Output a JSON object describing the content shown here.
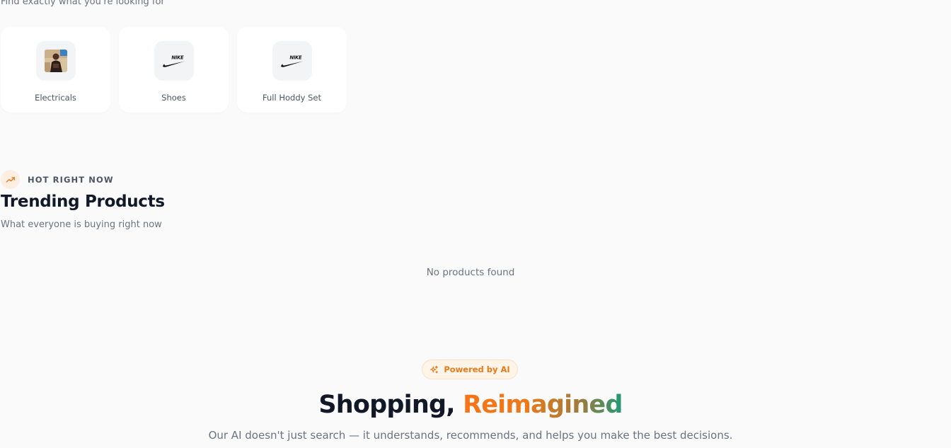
{
  "categories": {
    "subtitle": "Find exactly what you're looking for",
    "items": [
      {
        "label": "Electricals",
        "icon": "photo-thumbnail"
      },
      {
        "label": "Shoes",
        "icon": "nike-logo"
      },
      {
        "label": "Full Hoddy Set",
        "icon": "nike-logo"
      }
    ]
  },
  "trending": {
    "eyebrow": "HOT RIGHT NOW",
    "eyebrow_icon": "trending-up-icon",
    "title": "Trending Products",
    "subtitle": "What everyone is buying right now",
    "empty_message": "No products found"
  },
  "ai_section": {
    "pill_icon": "sparkles-icon",
    "pill_label": "Powered by AI",
    "title_plain": "Shopping,",
    "title_highlight": "Reimagined",
    "description": "Our AI doesn't just search — it understands, recommends, and helps you make the best decisions."
  },
  "colors": {
    "accent": "#ea7a1a",
    "gradient_end": "#1f9a74",
    "background": "#fafafa"
  }
}
